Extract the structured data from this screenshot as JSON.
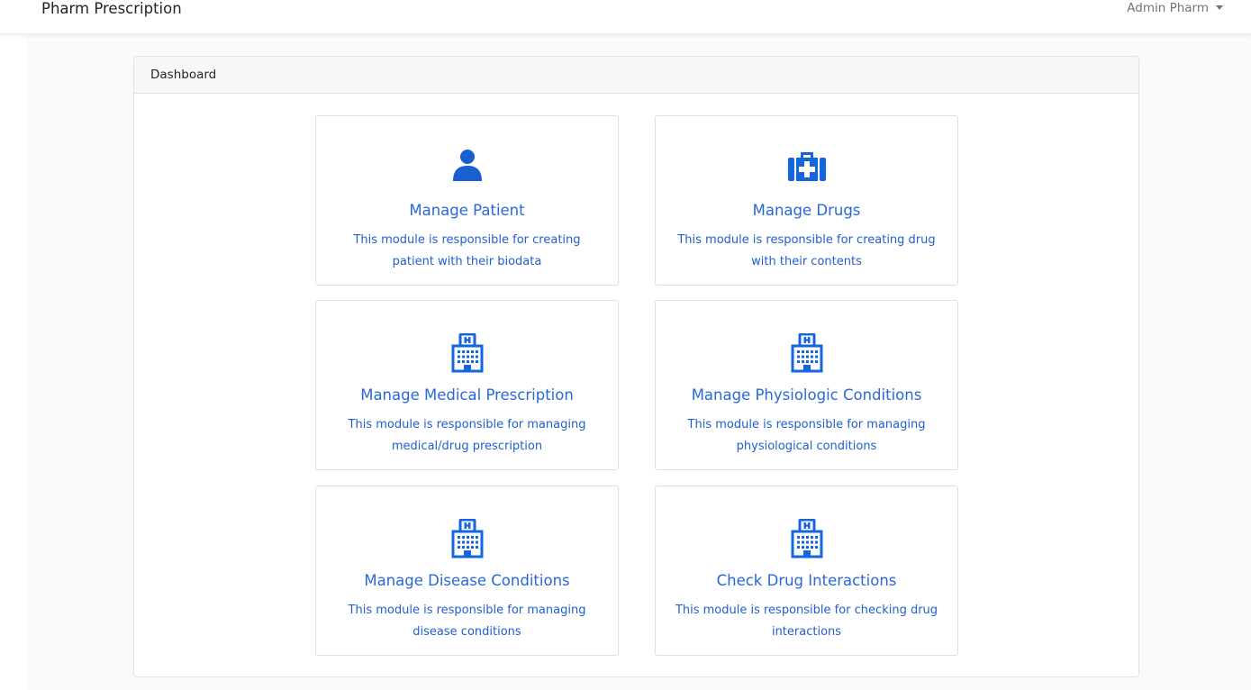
{
  "navbar": {
    "brand": "Pharm Prescription",
    "user": "Admin Pharm"
  },
  "dashboard": {
    "header": "Dashboard",
    "tiles": [
      {
        "icon": "user-icon",
        "title": "Manage Patient",
        "description": "This module is responsible for creating patient with their biodata"
      },
      {
        "icon": "medkit-icon",
        "title": "Manage Drugs",
        "description": "This module is responsible for creating drug with their contents"
      },
      {
        "icon": "hospital-icon",
        "title": "Manage Medical Prescription",
        "description": "This module is responsible for managing medical/drug prescription"
      },
      {
        "icon": "hospital-icon",
        "title": "Manage Physiologic Conditions",
        "description": "This module is responsible for managing physiological conditions"
      },
      {
        "icon": "hospital-icon",
        "title": "Manage Disease Conditions",
        "description": "This module is responsible for managing disease conditions"
      },
      {
        "icon": "hospital-icon",
        "title": "Check Drug Interactions",
        "description": "This module is responsible for checking drug interactions"
      }
    ]
  },
  "colors": {
    "accent": "#1466e0",
    "link_text": "#2a68d8"
  }
}
